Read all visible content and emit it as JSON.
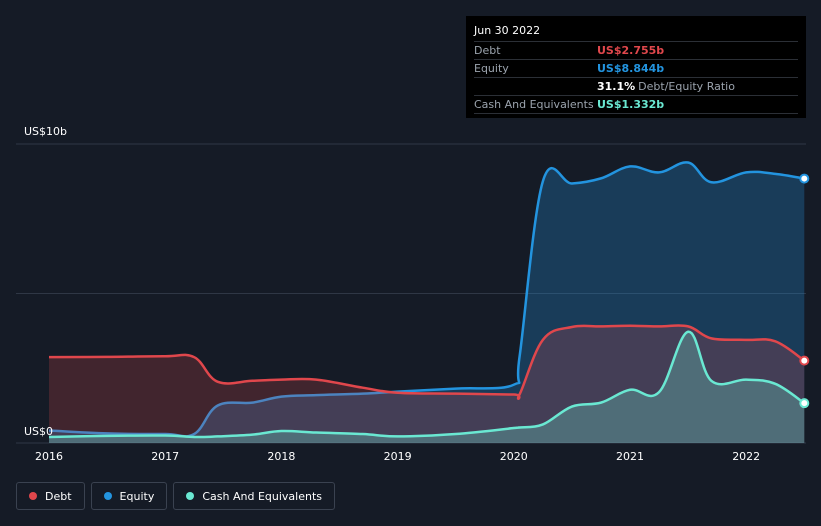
{
  "tooltip": {
    "date": "Jun 30 2022",
    "debt_label": "Debt",
    "debt_value": "US$2.755b",
    "equity_label": "Equity",
    "equity_value": "US$8.844b",
    "ratio_value": "31.1%",
    "ratio_label": "Debt/Equity Ratio",
    "cash_label": "Cash And Equivalents",
    "cash_value": "US$1.332b"
  },
  "legend": {
    "debt": "Debt",
    "equity": "Equity",
    "cash": "Cash And Equivalents"
  },
  "colors": {
    "debt": "#e0474c",
    "equity": "#2394df",
    "cash": "#6ae8d2",
    "background": "#151b26"
  },
  "chart_data": {
    "type": "area",
    "y_top_label": "US$10b",
    "y_bottom_label": "US$0",
    "ylim": [
      0,
      10
    ],
    "xlim": [
      2016,
      2022.5
    ],
    "x_ticks": [
      "2016",
      "2017",
      "2018",
      "2019",
      "2020",
      "2021",
      "2022"
    ],
    "series": [
      {
        "name": "Debt",
        "x": [
          2016,
          2016.5,
          2017,
          2017.25,
          2017.45,
          2017.75,
          2018,
          2018.3,
          2018.7,
          2019,
          2019.5,
          2020,
          2020.05,
          2020.25,
          2020.5,
          2020.75,
          2021,
          2021.25,
          2021.5,
          2021.7,
          2022,
          2022.25,
          2022.5
        ],
        "values": [
          2.87,
          2.88,
          2.9,
          2.87,
          2.05,
          2.08,
          2.12,
          2.12,
          1.85,
          1.68,
          1.65,
          1.62,
          1.63,
          3.45,
          3.88,
          3.9,
          3.92,
          3.9,
          3.9,
          3.5,
          3.45,
          3.4,
          2.755
        ]
      },
      {
        "name": "Equity",
        "x": [
          2016,
          2016.5,
          2017,
          2017.25,
          2017.45,
          2017.75,
          2018,
          2018.3,
          2018.7,
          2019,
          2019.5,
          2020,
          2020.05,
          2020.25,
          2020.5,
          2020.75,
          2021,
          2021.25,
          2021.5,
          2021.7,
          2022,
          2022.25,
          2022.5
        ],
        "values": [
          0.42,
          0.32,
          0.3,
          0.3,
          1.25,
          1.35,
          1.55,
          1.6,
          1.65,
          1.72,
          1.82,
          1.95,
          2.9,
          8.75,
          8.68,
          8.85,
          9.25,
          9.05,
          9.38,
          8.72,
          9.05,
          9.0,
          8.844
        ]
      },
      {
        "name": "Cash And Equivalents",
        "x": [
          2016,
          2016.5,
          2017,
          2017.25,
          2017.45,
          2017.75,
          2018,
          2018.3,
          2018.7,
          2019,
          2019.5,
          2020,
          2020.05,
          2020.25,
          2020.5,
          2020.75,
          2021,
          2021.25,
          2021.5,
          2021.7,
          2022,
          2022.25,
          2022.5
        ],
        "values": [
          0.2,
          0.24,
          0.25,
          0.2,
          0.22,
          0.28,
          0.4,
          0.35,
          0.3,
          0.22,
          0.3,
          0.5,
          0.52,
          0.62,
          1.22,
          1.35,
          1.78,
          1.7,
          3.72,
          2.08,
          2.12,
          1.98,
          1.332
        ]
      }
    ],
    "legend_position": "bottom-left",
    "grid": true
  }
}
